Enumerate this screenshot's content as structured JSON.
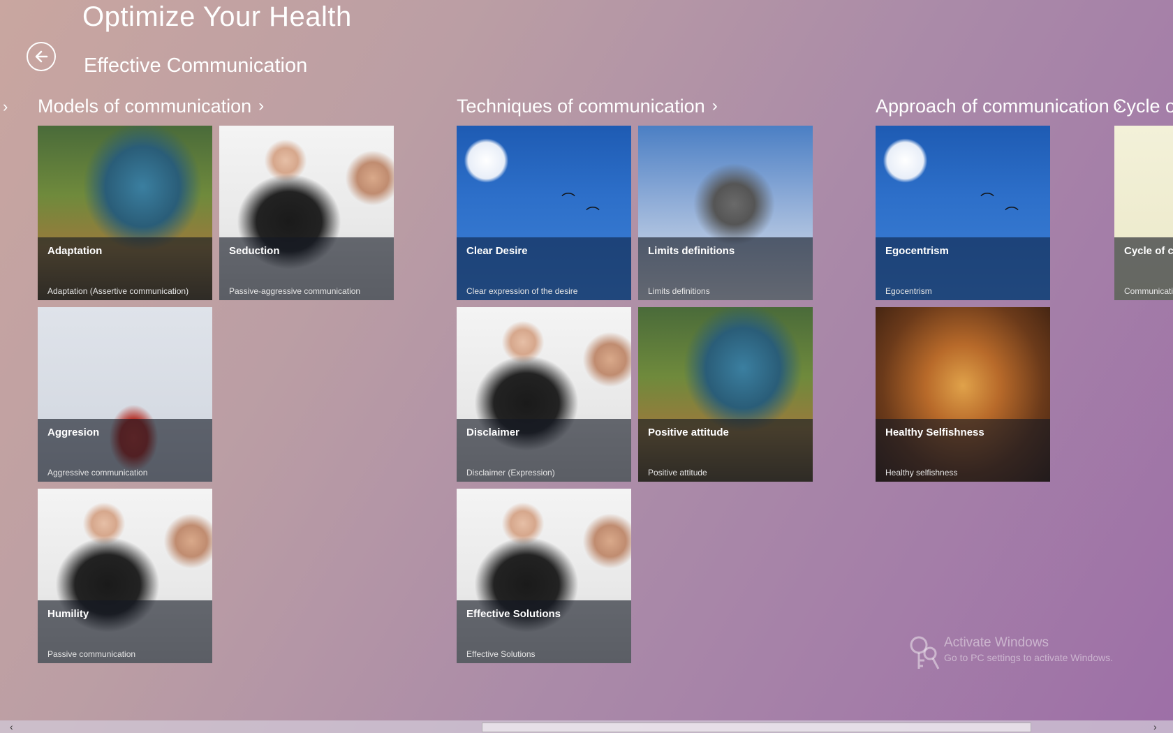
{
  "app": {
    "title": "Optimize Your Health",
    "subtitle": "Effective Communication"
  },
  "icons": {
    "back": "back-arrow-icon",
    "chevron": "chevron-right-icon",
    "key": "key-icon"
  },
  "groups": [
    {
      "header": "Models of communication",
      "chevron": "›",
      "tiles": [
        {
          "title": "Adaptation",
          "subtitle": "Adaptation (Assertive communication)"
        },
        {
          "title": "Seduction",
          "subtitle": "Passive-aggressive communication"
        },
        {
          "title": "Aggresion",
          "subtitle": "Aggressive communication"
        },
        {
          "title": "Humility",
          "subtitle": "Passive communication"
        }
      ]
    },
    {
      "header": "Techniques of communication",
      "chevron": "›",
      "tiles": [
        {
          "title": "Clear Desire",
          "subtitle": "Clear expression of the desire"
        },
        {
          "title": "Limits definitions",
          "subtitle": "Limits definitions"
        },
        {
          "title": "Disclaimer",
          "subtitle": "Disclaimer (Expression)"
        },
        {
          "title": "Positive attitude",
          "subtitle": "Positive attitude"
        },
        {
          "title": "Effective Solutions",
          "subtitle": "Effective Solutions"
        }
      ]
    },
    {
      "header": "Approach of communication",
      "chevron": "›",
      "tiles": [
        {
          "title": "Egocentrism",
          "subtitle": "Egocentrism"
        },
        {
          "title": "Healthy Selfishness",
          "subtitle": "Healthy selfishness"
        }
      ]
    },
    {
      "header": "Cycle of co",
      "tiles": [
        {
          "title": "Cycle of co",
          "subtitle": "Communicati"
        }
      ]
    }
  ],
  "watermark": {
    "title": "Activate Windows",
    "subtitle": "Go to PC settings to activate Windows."
  },
  "scrollbar": {
    "left_arrow": "‹",
    "right_arrow": "›"
  },
  "left_chevron": "›"
}
